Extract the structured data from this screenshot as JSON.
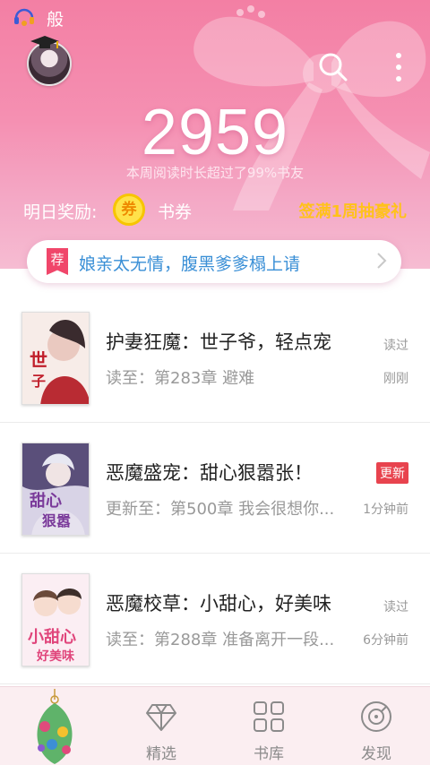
{
  "status_bar": {
    "text": "般"
  },
  "header": {
    "reading_minutes": "2959",
    "rank_text": "本周阅读时长超过了99%书友",
    "reward_label": "明日奖励:",
    "coupon_icon_text": "券",
    "coupon_text": "书券",
    "signin_reward": "签满1周抽豪礼",
    "recommend": {
      "tag": "荐",
      "title": "娘亲太无情，腹黑爹爹榻上请"
    }
  },
  "books": [
    {
      "title": "护妻狂魔：世子爷，轻点宠",
      "progress": "读至：第283章 避难",
      "status": "读过",
      "time": "刚刚",
      "badge": ""
    },
    {
      "title": "恶魔盛宠：甜心狠嚣张！",
      "progress": "更新至：第500章 我会很想你...",
      "status": "",
      "time": "1分钟前",
      "badge": "更新"
    },
    {
      "title": "恶魔校草：小甜心，好美味",
      "progress": "读至：第288章 准备离开一段...",
      "status": "读过",
      "time": "6分钟前",
      "badge": ""
    }
  ],
  "bottom_nav": {
    "items": [
      {
        "label": "精选",
        "icon": "diamond-icon"
      },
      {
        "label": "书库",
        "icon": "grid-icon"
      },
      {
        "label": "发现",
        "icon": "compass-icon"
      }
    ]
  },
  "colors": {
    "header_pink": "#f37fa4",
    "accent_yellow": "#ffc21a",
    "link_blue": "#3a8fd6",
    "badge_red": "#e8434e"
  }
}
